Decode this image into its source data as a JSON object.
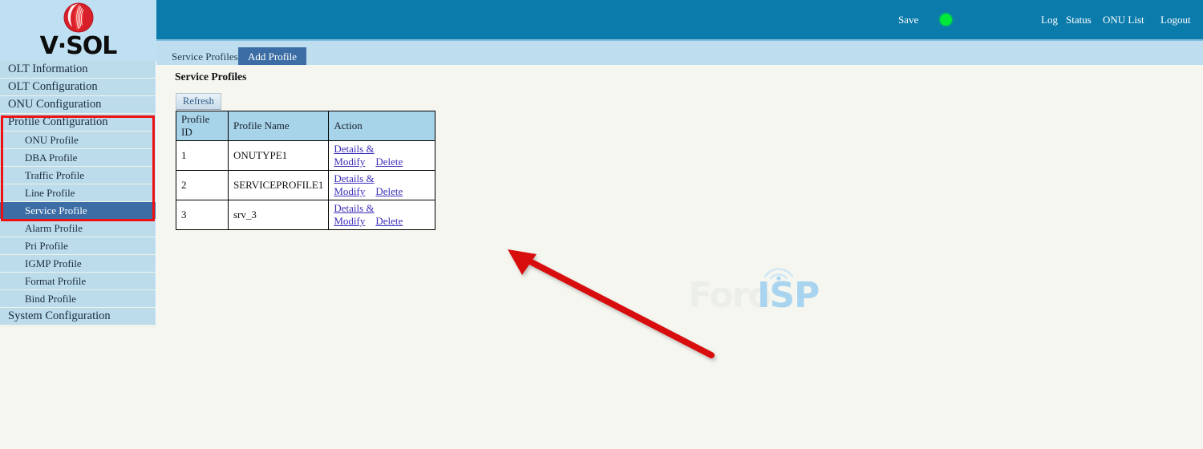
{
  "brand": {
    "logo_icon": "vsol-sphere-logo",
    "wordmark": "V·SOL"
  },
  "header": {
    "save_label": "Save",
    "status_indicator": {
      "icon": "status-dot-icon",
      "color": "#00e838",
      "state": "online"
    },
    "links": [
      {
        "label": "Log"
      },
      {
        "label": "Status"
      },
      {
        "label": "ONU List"
      },
      {
        "label": "Logout"
      }
    ],
    "background_color": "#0b7bab"
  },
  "sidebar": {
    "items": [
      {
        "label": "OLT Information",
        "level": "top",
        "selected": false
      },
      {
        "label": "OLT Configuration",
        "level": "top",
        "selected": false
      },
      {
        "label": "ONU Configuration",
        "level": "top",
        "selected": false
      },
      {
        "label": "Profile Configuration",
        "level": "top",
        "selected": false
      },
      {
        "label": "ONU Profile",
        "level": "sub",
        "selected": false
      },
      {
        "label": "DBA Profile",
        "level": "sub",
        "selected": false
      },
      {
        "label": "Traffic Profile",
        "level": "sub",
        "selected": false
      },
      {
        "label": "Line Profile",
        "level": "sub",
        "selected": false
      },
      {
        "label": "Service Profile",
        "level": "sub",
        "selected": true
      },
      {
        "label": "Alarm Profile",
        "level": "sub",
        "selected": false
      },
      {
        "label": "Pri Profile",
        "level": "sub",
        "selected": false
      },
      {
        "label": "IGMP Profile",
        "level": "sub",
        "selected": false
      },
      {
        "label": "Format Profile",
        "level": "sub",
        "selected": false
      },
      {
        "label": "Bind Profile",
        "level": "sub",
        "selected": false
      },
      {
        "label": "System Configuration",
        "level": "top",
        "selected": false
      }
    ],
    "item_background": "#bcdcec",
    "selected_background": "#3c6ea5"
  },
  "annotations": {
    "highlight_box_color": "#ee1111",
    "arrow_color": "#d80808",
    "arrow_points_to": "Details & Modify link of profile 3"
  },
  "tabs": [
    {
      "label": "Service Profiles",
      "active": false
    },
    {
      "label": "Add Profile",
      "active": true
    }
  ],
  "main": {
    "title": "Service Profiles",
    "refresh_label": "Refresh",
    "table": {
      "columns": [
        "Profile ID",
        "Profile Name",
        "Action"
      ],
      "rows": [
        {
          "id": "1",
          "name": "ONUTYPE1",
          "details_label": "Details & Modify",
          "delete_label": "Delete"
        },
        {
          "id": "2",
          "name": "SERVICEPROFILE1",
          "details_label": "Details & Modify",
          "delete_label": "Delete"
        },
        {
          "id": "3",
          "name": "srv_3",
          "details_label": "Details & Modify",
          "delete_label": "Delete"
        }
      ]
    }
  },
  "watermark": {
    "text_primary": "Foro",
    "text_accent": "ISP",
    "icon": "wifi-signal-icon",
    "primary_color": "#eceee8",
    "accent_color": "#a8d4ef"
  }
}
